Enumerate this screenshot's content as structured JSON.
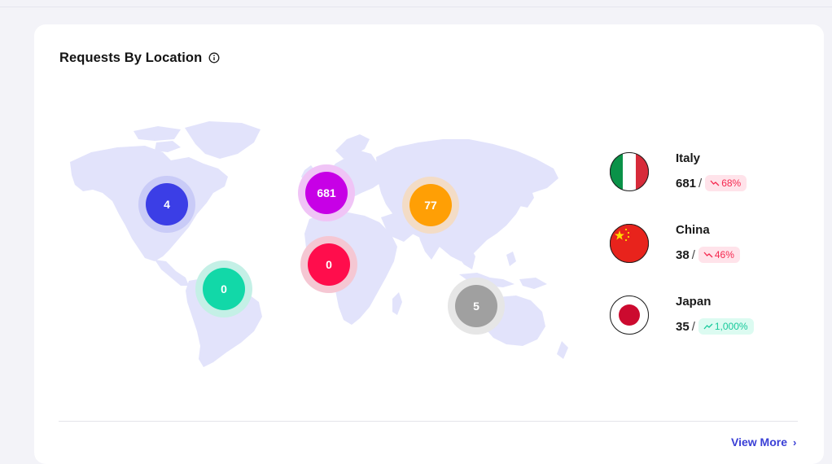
{
  "card": {
    "title": "Requests By Location"
  },
  "map": {
    "land_color": "#e2e3fb",
    "markers": [
      {
        "label": "4",
        "color": "#3b3ee6",
        "halo": "#c9cbf7"
      },
      {
        "label": "681",
        "color": "#c700e6",
        "halo": "#f0c4f6"
      },
      {
        "label": "77",
        "color": "#ff9f05",
        "halo": "#f3dcc6"
      },
      {
        "label": "0",
        "color": "#ff0d4c",
        "halo": "#f5c7d3"
      },
      {
        "label": "0",
        "color": "#12d8a8",
        "halo": "#c4f0e6"
      },
      {
        "label": "5",
        "color": "#a0a0a0",
        "halo": "#e6e6e6"
      }
    ]
  },
  "countries": [
    {
      "name": "Italy",
      "value": "681",
      "change": "68%",
      "trend": "down",
      "flag_icon": "italy-flag-icon"
    },
    {
      "name": "China",
      "value": "38",
      "change": "46%",
      "trend": "down",
      "flag_icon": "china-flag-icon"
    },
    {
      "name": "Japan",
      "value": "35",
      "change": "1,000%",
      "trend": "up",
      "flag_icon": "japan-flag-icon"
    }
  ],
  "slash": "/",
  "footer": {
    "view_more": "View More",
    "chevron": "›"
  },
  "colors": {
    "accent": "#3a3fd6",
    "down": "#f5284f",
    "down_bg": "#ffe3ea",
    "up": "#18c99b",
    "up_bg": "#dcfbf1"
  }
}
